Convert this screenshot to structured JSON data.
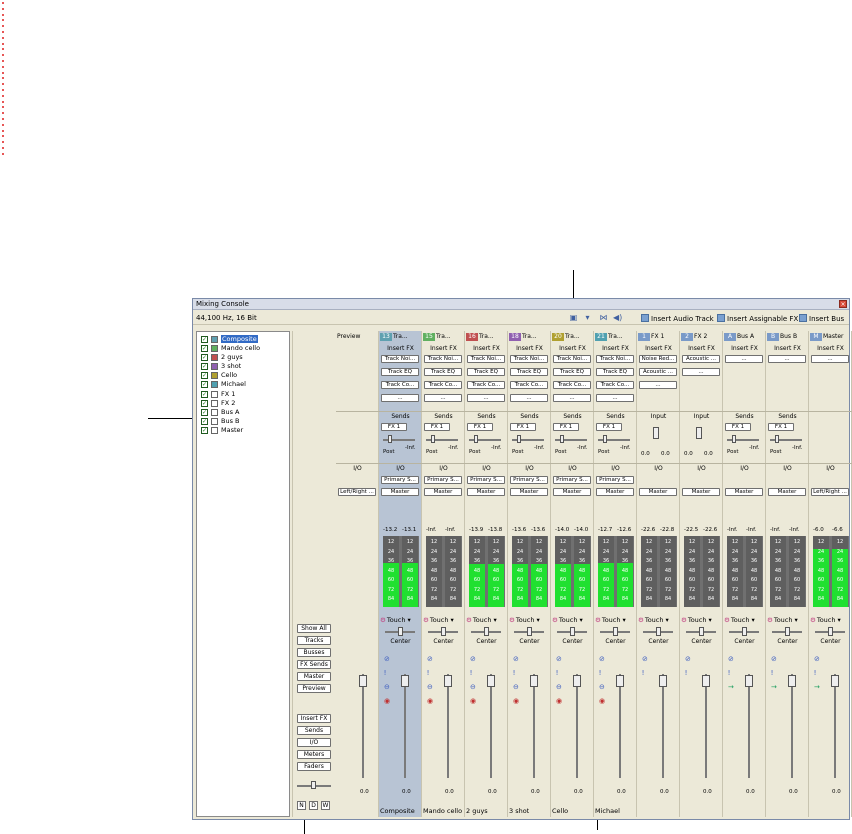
{
  "window": {
    "title": "Mixing Console",
    "format": "44,100 Hz, 16 Bit"
  },
  "toolbar": {
    "insert_audio_track": "Insert Audio Track",
    "insert_assignable_fx": "Insert Assignable FX",
    "insert_bus": "Insert Bus"
  },
  "track_list": [
    {
      "label": "Composite",
      "color": "#5fa0b0"
    },
    {
      "label": "Mando cello",
      "color": "#60b060"
    },
    {
      "label": "2 guys",
      "color": "#c05050"
    },
    {
      "label": "3 shot",
      "color": "#9060b0"
    },
    {
      "label": "Cello",
      "color": "#b0a030"
    },
    {
      "label": "Michael",
      "color": "#50a0b0"
    },
    {
      "label": "FX 1",
      "color": "#ffffff"
    },
    {
      "label": "FX 2",
      "color": "#ffffff"
    },
    {
      "label": "Bus A",
      "color": "#ffffff"
    },
    {
      "label": "Bus B",
      "color": "#ffffff"
    },
    {
      "label": "Master",
      "color": "#ffffff"
    }
  ],
  "view_buttons": [
    "Show All",
    "Tracks",
    "Busses",
    "FX Sends",
    "Master",
    "Preview",
    "Insert FX",
    "Sends",
    "I/O",
    "Meters",
    "Faders"
  ],
  "mini_buttons": [
    "N",
    "D",
    "W"
  ],
  "strips": [
    {
      "num": "",
      "title": "Preview",
      "insert_fx": "",
      "fx": [],
      "sends": "",
      "send_target": "",
      "io": "I/O",
      "route1": "",
      "route2": "",
      "meter": [
        "",
        ""
      ],
      "meter_fill": [
        0,
        0
      ],
      "name": "",
      "fval": "0.0",
      "color": "#ffffff",
      "has_auto": false,
      "hl": false
    },
    {
      "num": "13",
      "title": "Tra...",
      "insert_fx": "Insert FX",
      "fx": [
        "Track Noi...",
        "Track EQ",
        "Track Co...",
        "..."
      ],
      "sends": "Sends",
      "send_target": "FX 1",
      "io": "I/O",
      "route1": "Primary S...",
      "route2": "Master",
      "meter": [
        "-13.2",
        "-13.1"
      ],
      "meter_fill": [
        0.62,
        0.62
      ],
      "name": "Composite",
      "fval": "0.0",
      "color": "#5fa0b0",
      "has_auto": true,
      "hl": true
    },
    {
      "num": "15",
      "title": "Tra...",
      "insert_fx": "Insert FX",
      "fx": [
        "Track Noi...",
        "Track EQ",
        "Track Co...",
        "..."
      ],
      "sends": "Sends",
      "send_target": "FX 1",
      "io": "I/O",
      "route1": "Primary S...",
      "route2": "Master",
      "meter": [
        "-Inf.",
        "-Inf."
      ],
      "meter_fill": [
        0,
        0
      ],
      "name": "Mando cello",
      "fval": "0.0",
      "color": "#60b060",
      "has_auto": true,
      "hl": false
    },
    {
      "num": "16",
      "title": "Tra...",
      "insert_fx": "Insert FX",
      "fx": [
        "Track Noi...",
        "Track EQ",
        "Track Co...",
        "..."
      ],
      "sends": "Sends",
      "send_target": "FX 1",
      "io": "I/O",
      "route1": "Primary S...",
      "route2": "Master",
      "meter": [
        "-13.9",
        "-13.8"
      ],
      "meter_fill": [
        0.6,
        0.6
      ],
      "name": "2 guys",
      "fval": "0.0",
      "color": "#c05050",
      "has_auto": true,
      "hl": false
    },
    {
      "num": "18",
      "title": "Tra...",
      "insert_fx": "Insert FX",
      "fx": [
        "Track Noi...",
        "Track EQ",
        "Track Co...",
        "..."
      ],
      "sends": "Sends",
      "send_target": "FX 1",
      "io": "I/O",
      "route1": "Primary S...",
      "route2": "Master",
      "meter": [
        "-13.6",
        "-13.6"
      ],
      "meter_fill": [
        0.6,
        0.6
      ],
      "name": "3 shot",
      "fval": "0.0",
      "color": "#9060b0",
      "has_auto": true,
      "hl": false
    },
    {
      "num": "20",
      "title": "Tra...",
      "insert_fx": "Insert FX",
      "fx": [
        "Track Noi...",
        "Track EQ",
        "Track Co...",
        "..."
      ],
      "sends": "Sends",
      "send_target": "FX 1",
      "io": "I/O",
      "route1": "Primary S...",
      "route2": "Master",
      "meter": [
        "-14.0",
        "-14.0"
      ],
      "meter_fill": [
        0.6,
        0.6
      ],
      "name": "Cello",
      "fval": "0.0",
      "color": "#b0a030",
      "has_auto": true,
      "hl": false
    },
    {
      "num": "21",
      "title": "Tra...",
      "insert_fx": "Insert FX",
      "fx": [
        "Track Noi...",
        "Track EQ",
        "Track Co...",
        "..."
      ],
      "sends": "Sends",
      "send_target": "FX 1",
      "io": "I/O",
      "route1": "Primary S...",
      "route2": "Master",
      "meter": [
        "-12.7",
        "-12.6"
      ],
      "meter_fill": [
        0.62,
        0.62
      ],
      "name": "Michael",
      "fval": "0.0",
      "color": "#50a0b0",
      "has_auto": true,
      "hl": false
    },
    {
      "num": "1",
      "title": "FX 1",
      "insert_fx": "Insert FX",
      "fx": [
        "Noise Red...",
        "Acoustic ...",
        "..."
      ],
      "sends": "Input",
      "send_target": "",
      "io": "I/O",
      "route1": "",
      "route2": "Master",
      "meter": [
        "-22.6",
        "-22.8"
      ],
      "meter_fill": [
        0,
        0
      ],
      "name": "",
      "fval": "0.0",
      "color": "#ffffff",
      "has_auto": true,
      "hl": false
    },
    {
      "num": "2",
      "title": "FX 2",
      "insert_fx": "Insert FX",
      "fx": [
        "Acoustic ...",
        "..."
      ],
      "sends": "Input",
      "send_target": "",
      "io": "I/O",
      "route1": "",
      "route2": "Master",
      "meter": [
        "-22.5",
        "-22.6"
      ],
      "meter_fill": [
        0,
        0
      ],
      "name": "",
      "fval": "0.0",
      "color": "#ffffff",
      "has_auto": true,
      "hl": false
    },
    {
      "num": "A",
      "title": "Bus A",
      "insert_fx": "Insert FX",
      "fx": [
        "..."
      ],
      "sends": "Sends",
      "send_target": "FX 1",
      "io": "I/O",
      "route1": "",
      "route2": "Master",
      "meter": [
        "-Inf.",
        "-Inf."
      ],
      "meter_fill": [
        0,
        0
      ],
      "name": "",
      "fval": "0.0",
      "color": "#ffffff",
      "has_auto": true,
      "hl": false
    },
    {
      "num": "B",
      "title": "Bus B",
      "insert_fx": "Insert FX",
      "fx": [
        "..."
      ],
      "sends": "Sends",
      "send_target": "FX 1",
      "io": "I/O",
      "route1": "",
      "route2": "Master",
      "meter": [
        "-Inf.",
        "-Inf."
      ],
      "meter_fill": [
        0,
        0
      ],
      "name": "",
      "fval": "0.0",
      "color": "#ffffff",
      "has_auto": true,
      "hl": false
    },
    {
      "num": "M",
      "title": "Master",
      "insert_fx": "Insert FX",
      "fx": [
        "..."
      ],
      "sends": "",
      "send_target": "",
      "io": "I/O",
      "route1": "",
      "route2": "",
      "meter": [
        "-6.0",
        "-6.6"
      ],
      "meter_fill": [
        0.82,
        0.82
      ],
      "name": "",
      "fval": "0.0",
      "color": "#ffffff",
      "has_auto": true,
      "hl": false
    }
  ],
  "shared": {
    "post": "Post",
    "inf": "-Inf.",
    "center": "Center",
    "touch": "Touch",
    "left_right": "Left/Right ...",
    "zero": "0.0",
    "ticks": [
      "12",
      "24",
      "36",
      "48",
      "60",
      "72",
      "84"
    ]
  }
}
